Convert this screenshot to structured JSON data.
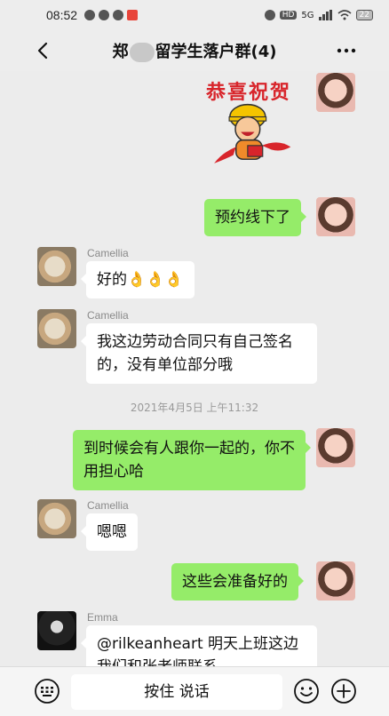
{
  "statusbar": {
    "time": "08:52",
    "network": "5G",
    "battery": "22"
  },
  "header": {
    "title_prefix": "郑",
    "title_suffix": "留学生落户群(4)",
    "back_icon": "chevron-left-icon",
    "more_icon": "ellipsis-icon"
  },
  "sticker": {
    "text": "恭喜祝贺"
  },
  "messages": [
    {
      "side": "right",
      "text": "预约线下了"
    },
    {
      "side": "left",
      "sender": "Camellia",
      "text": "好的👌👌👌"
    },
    {
      "side": "left",
      "sender": "Camellia",
      "text": "我这边劳动合同只有自己签名的，没有单位部分哦"
    },
    {
      "side": "right",
      "text": "到时候会有人跟你一起的，你不用担心哈"
    },
    {
      "side": "left",
      "sender": "Camellia",
      "text": "嗯嗯"
    },
    {
      "side": "right",
      "text": "这些会准备好的"
    },
    {
      "side": "left",
      "sender": "Emma",
      "text": "@rilkeanheart  明天上班这边我们和张老师联系"
    }
  ],
  "timestamp": "2021年4月5日 上午11:32",
  "bottombar": {
    "voice_label": "按住 说话"
  },
  "colors": {
    "bubble_green": "#95ec69",
    "bubble_white": "#ffffff",
    "background": "#ececec"
  }
}
